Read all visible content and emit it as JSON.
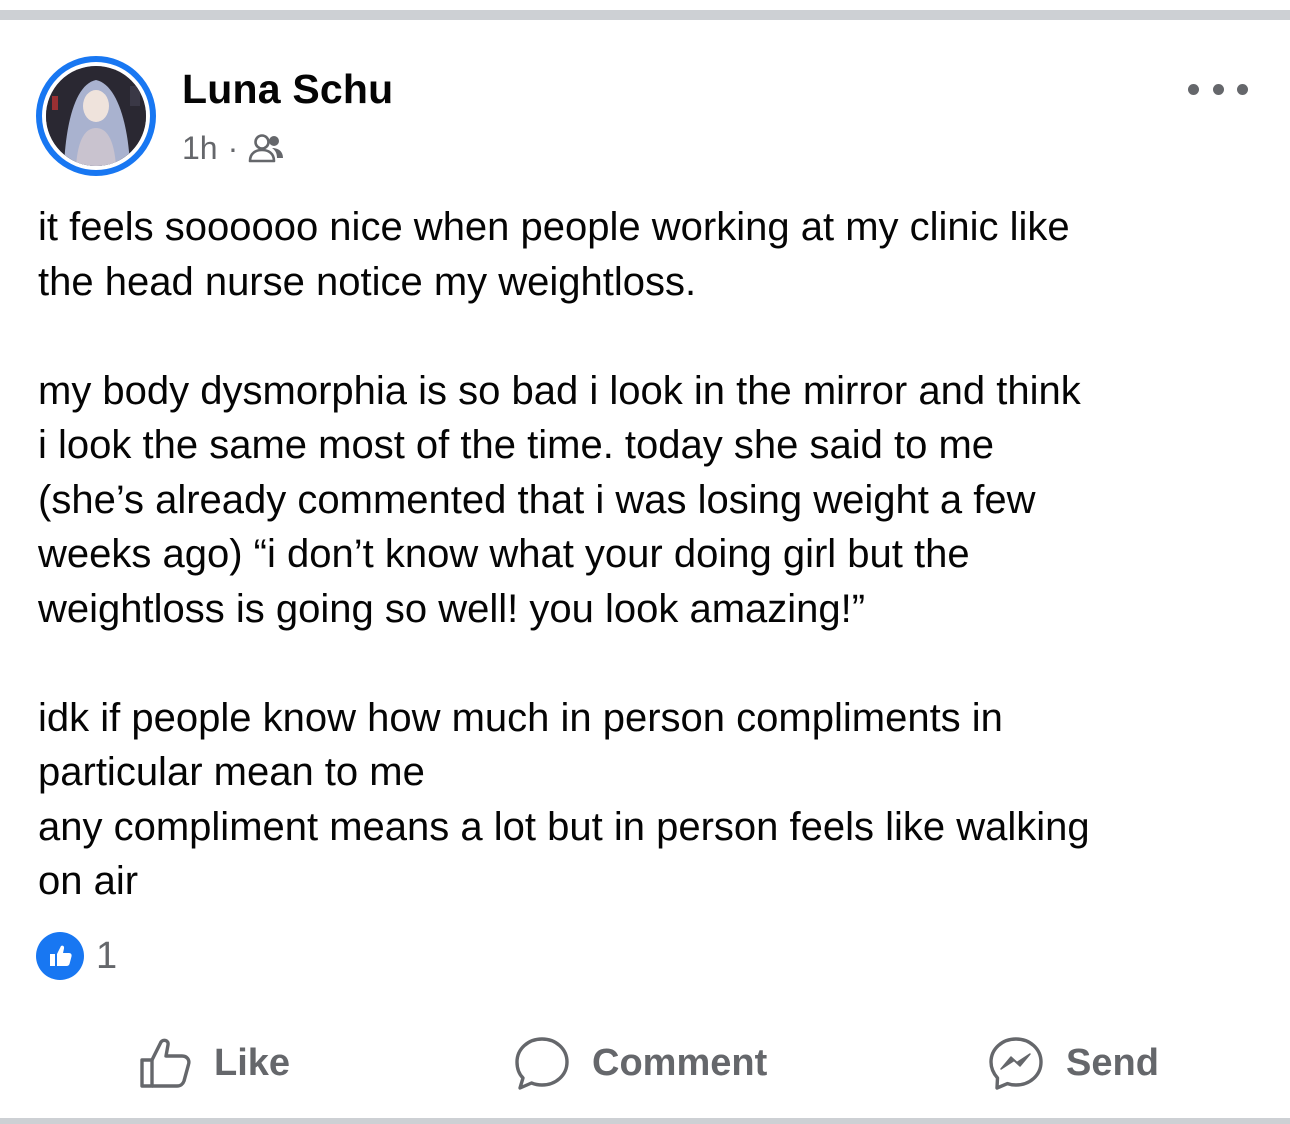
{
  "post": {
    "author": "Luna Schu",
    "time": "1h",
    "separator": "·",
    "audience_icon": "friends-icon",
    "body": [
      "it feels soooooo nice when people working at my clinic like\nthe head nurse notice my weightloss.",
      "my body dysmorphia is so bad i look in the mirror and think\ni look the same most of the time. today she said to me\n(she’s already commented that i was losing weight a few\nweeks ago) “i don’t know what your doing girl but the\nweightloss is going so well! you look amazing!”",
      "idk if people know how much in person compliments in\nparticular mean to me\nany compliment means a lot but in person feels like walking\non air"
    ]
  },
  "reactions": {
    "icon": "thumbs-up-icon",
    "count": "1"
  },
  "actions": {
    "like_label": "Like",
    "comment_label": "Comment",
    "send_label": "Send"
  },
  "colors": {
    "accent": "#1877f2",
    "secondary_text": "#65676b",
    "divider": "#cdd0d4"
  }
}
